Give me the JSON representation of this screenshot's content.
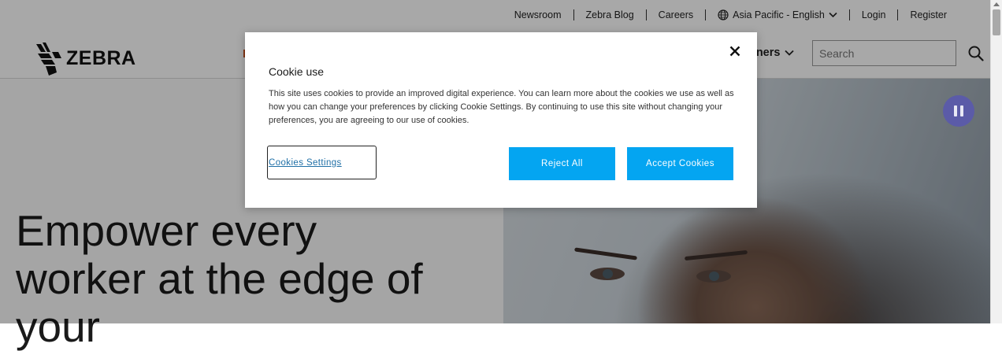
{
  "utility_nav": {
    "items": [
      "Newsroom",
      "Zebra Blog",
      "Careers"
    ],
    "locale": "Asia Pacific - English",
    "login": "Login",
    "register": "Register"
  },
  "header": {
    "logo_text": "ZEBRA",
    "nav_partners": "tners",
    "search_placeholder": "Search"
  },
  "hero": {
    "title": "Empower every worker at the edge of your"
  },
  "cookie_modal": {
    "title": "Cookie use",
    "description": "This site uses cookies to provide an improved digital experience. You can learn more about the cookies we use as well as how you can change your preferences by clicking Cookie Settings. By continuing to use this site without changing your preferences, you are agreeing to our use of cookies.",
    "settings_label": "Cookies Settings",
    "reject_label": "Reject All",
    "accept_label": "Accept Cookies"
  },
  "colors": {
    "accent_blue": "#04a5f1",
    "pause_button": "#5b5ba8",
    "nav_accent": "#c8501e"
  },
  "icons": {
    "globe": "globe-icon",
    "chevron": "chevron-down-icon",
    "search": "search-icon",
    "close": "close-icon",
    "pause": "pause-icon"
  }
}
